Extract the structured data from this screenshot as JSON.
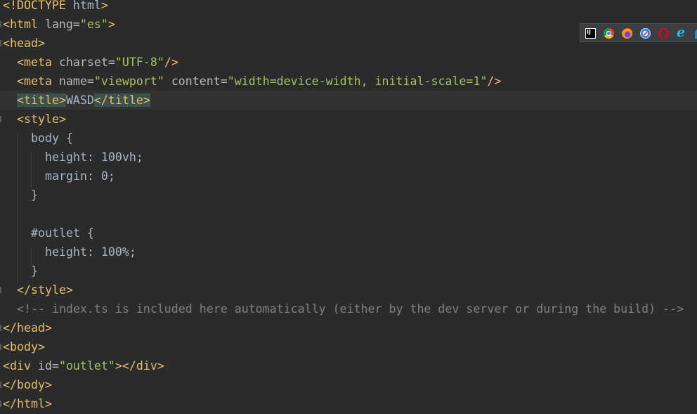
{
  "editor": {
    "lines": {
      "l1": {
        "doctype": "<!DOCTYPE",
        "doctype_name": "html",
        "close": ">"
      },
      "l2": {
        "open": "<html",
        "attr": "lang=",
        "value": "\"es\"",
        "close": ">"
      },
      "l3": {
        "tag": "<head>"
      },
      "l4": {
        "open": "<meta",
        "attr": "charset=",
        "value": "\"UTF-8\"",
        "close": "/>"
      },
      "l5": {
        "open": "<meta",
        "attr1": "name=",
        "value1": "\"viewport\"",
        "attr2": "content=",
        "value2": "\"width=device-width, initial-scale=1\"",
        "close": "/>"
      },
      "l6": {
        "open": "<title>",
        "text": "WASD",
        "close": "</title>"
      },
      "l7": {
        "tag": "<style>"
      },
      "l8": {
        "text": "body {"
      },
      "l9": {
        "text": "height: 100vh;"
      },
      "l10": {
        "text": "margin: 0;"
      },
      "l11": {
        "text": "}"
      },
      "l12": {
        "text": ""
      },
      "l13": {
        "text": "#outlet {"
      },
      "l14": {
        "text": "height: 100%;"
      },
      "l15": {
        "text": "}"
      },
      "l16": {
        "tag": "</style>"
      },
      "l17": {
        "comment": "<!-- index.ts is included here automatically (either by the dev server or during the build) -->"
      },
      "l18": {
        "tag": "</head>"
      },
      "l19": {
        "tag": "<body>"
      },
      "l20": {
        "open": "<div",
        "attr": "id=",
        "value": "\"outlet\"",
        "close": "></div>"
      },
      "l21": {
        "tag": "</body>"
      },
      "l22": {
        "tag": "</html>"
      }
    }
  },
  "browser_bar": {
    "icons": [
      "intellij-icon",
      "chrome-icon",
      "firefox-icon",
      "safari-icon",
      "opera-icon",
      "internet-explorer-icon",
      "edge-icon"
    ]
  },
  "colors": {
    "background": "#2b2b2b",
    "current_line": "#323232",
    "tag": "#e8bf6a",
    "attribute_value": "#a5c25c",
    "comment": "#808080",
    "text": "#a9b7c6"
  }
}
